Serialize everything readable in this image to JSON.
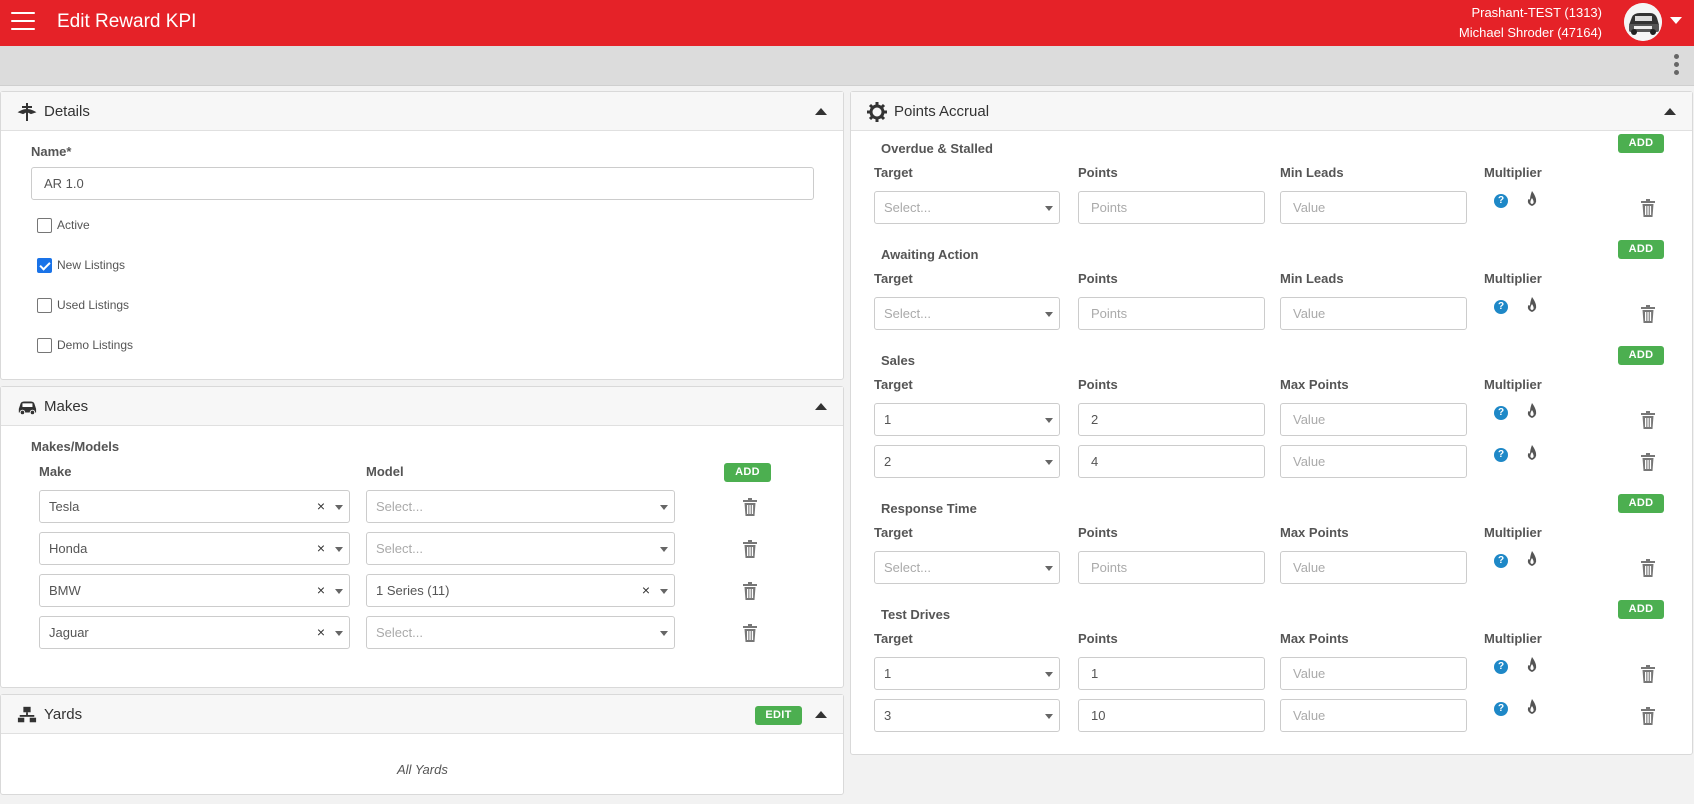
{
  "header": {
    "title": "Edit Reward KPI",
    "user_line1": "Prashant-TEST (1313)",
    "user_line2": "Michael Shroder (47164)",
    "brand_color": "#e52228"
  },
  "details": {
    "title": "Details",
    "name_label": "Name*",
    "name_value": "AR 1.0",
    "checkboxes": [
      {
        "label": "Active",
        "checked": false
      },
      {
        "label": "New Listings",
        "checked": true
      },
      {
        "label": "Used Listings",
        "checked": false
      },
      {
        "label": "Demo Listings",
        "checked": false
      }
    ]
  },
  "makes": {
    "title": "Makes",
    "section_label": "Makes/Models",
    "col_make": "Make",
    "col_model": "Model",
    "add_label": "ADD",
    "rows": [
      {
        "make": "Tesla",
        "model": "Select...",
        "model_placeholder": true
      },
      {
        "make": "Honda",
        "model": "Select...",
        "model_placeholder": true
      },
      {
        "make": "BMW",
        "model": "1 Series (11)",
        "model_placeholder": false
      },
      {
        "make": "Jaguar",
        "model": "Select...",
        "model_placeholder": true
      }
    ]
  },
  "yards": {
    "title": "Yards",
    "edit_label": "EDIT",
    "note": "All Yards"
  },
  "points": {
    "title": "Points Accrual",
    "add_label": "ADD",
    "col_target": "Target",
    "col_points": "Points",
    "col_multiplier": "Multiplier",
    "sections": [
      {
        "title": "Overdue & Stalled",
        "third_col": "Min Leads",
        "rows": [
          {
            "target": "Select...",
            "target_ph": true,
            "points": "Points",
            "points_ph": true,
            "third": "Value",
            "third_ph": true
          }
        ]
      },
      {
        "title": "Awaiting Action",
        "third_col": "Min Leads",
        "rows": [
          {
            "target": "Select...",
            "target_ph": true,
            "points": "Points",
            "points_ph": true,
            "third": "Value",
            "third_ph": true
          }
        ]
      },
      {
        "title": "Sales",
        "third_col": "Max Points",
        "rows": [
          {
            "target": "1",
            "target_ph": false,
            "points": "2",
            "points_ph": false,
            "third": "Value",
            "third_ph": true
          },
          {
            "target": "2",
            "target_ph": false,
            "points": "4",
            "points_ph": false,
            "third": "Value",
            "third_ph": true
          }
        ]
      },
      {
        "title": "Response Time",
        "third_col": "Max Points",
        "rows": [
          {
            "target": "Select...",
            "target_ph": true,
            "points": "Points",
            "points_ph": true,
            "third": "Value",
            "third_ph": true
          }
        ]
      },
      {
        "title": "Test Drives",
        "third_col": "Max Points",
        "rows": [
          {
            "target": "1",
            "target_ph": false,
            "points": "1",
            "points_ph": false,
            "third": "Value",
            "third_ph": true
          },
          {
            "target": "3",
            "target_ph": false,
            "points": "10",
            "points_ph": false,
            "third": "Value",
            "third_ph": true
          }
        ]
      }
    ]
  },
  "icons": {
    "help": "?"
  }
}
